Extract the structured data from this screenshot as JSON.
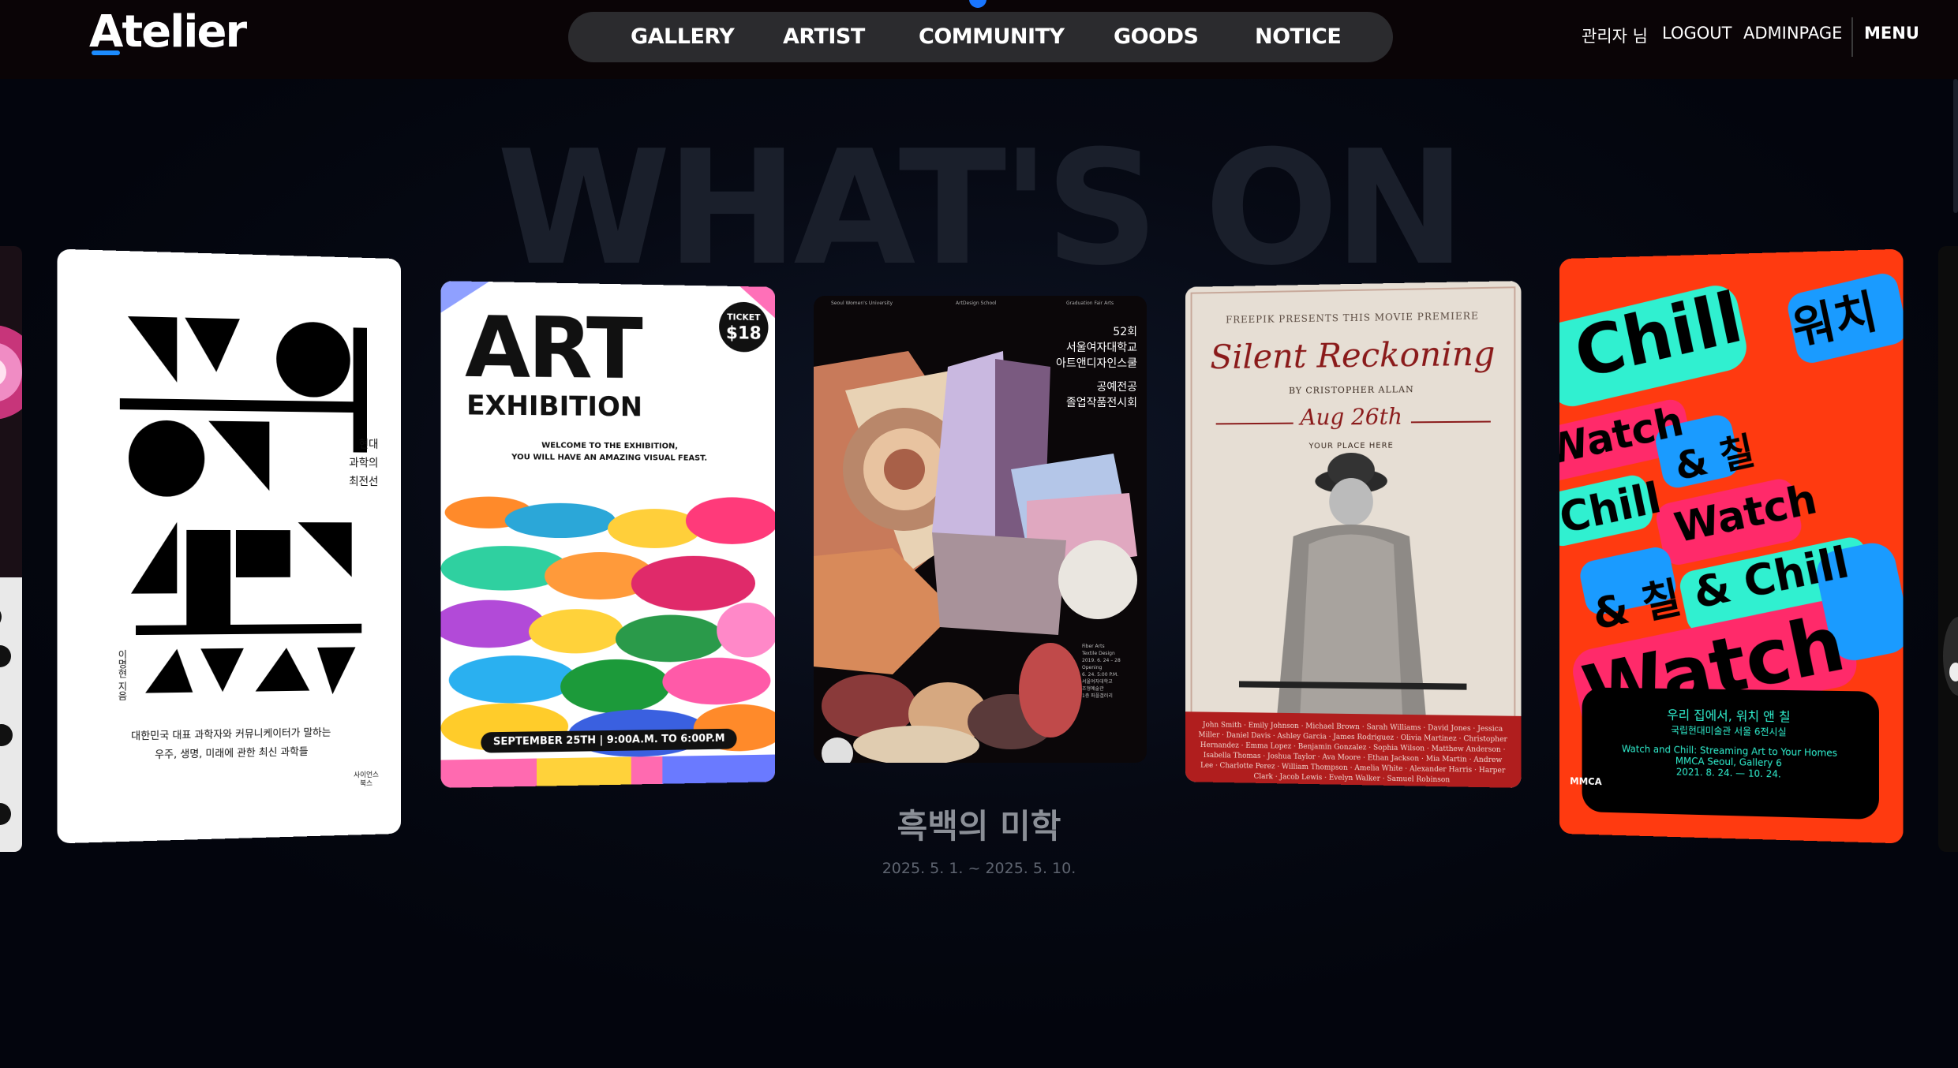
{
  "header": {
    "logo": "Atelier",
    "nav": [
      "GALLERY",
      "ARTIST",
      "COMMUNITY",
      "GOODS",
      "NOTICE"
    ],
    "user_label": "관리자 님",
    "logout": "LOGOUT",
    "adminpage": "ADMINPAGE",
    "menu": "MENU"
  },
  "hero": {
    "heading": "WHAT'S ON",
    "featured_title": "흑백의 미학",
    "featured_dates": "2025. 5. 1. ~ 2025. 5. 10."
  },
  "posters": {
    "p1": {
      "side_text": [
        "현대",
        "과학의",
        "최전선"
      ],
      "author": "이명현 지음",
      "desc_line1": "대한민국 대표 과학자와 커뮤니케이터가 말하는",
      "desc_line2": "우주, 생명, 미래에 관한 최신 과학들",
      "publisher": "사이언스 북스"
    },
    "p2": {
      "title": "ART",
      "subtitle": "EXHIBITION",
      "ticket_label": "TICKET",
      "ticket_price": "$18",
      "welcome1": "WELCOME TO THE EXHIBITION,",
      "welcome2": "YOU WILL HAVE AN AMAZING VISUAL FEAST.",
      "date_bar": "SEPTEMBER 25TH  |  9:00A.M. TO 6:00P.M"
    },
    "p3": {
      "top_left": "Seoul Women's University",
      "top_mid": "ArtDesign School",
      "top_right": "Graduation Fair Arts",
      "line1": "52회",
      "line2": "서울여자대학교",
      "line3": "아트앤디자인스쿨",
      "line4": "공예전공",
      "line5": "졸업작품전시회",
      "foot1": "Fiber Arts",
      "foot2": "Textile Design",
      "foot3": "2019. 6. 24 – 28",
      "foot4": "Opening",
      "foot5": "6. 24. 5:00 P.M.",
      "foot6": "서울여자대학교",
      "foot7": "조형예술관",
      "foot8": "1층 퍼플갤러리"
    },
    "p4": {
      "presents": "FREEPIK PRESENTS THIS MOVIE PREMIERE",
      "title": "Silent Reckoning",
      "by": "BY CRISTOPHER ALLAN",
      "date": "Aug 26th",
      "place": "YOUR PLACE HERE",
      "credits": "John Smith · Emily Johnson · Michael Brown · Sarah Williams · David Jones · Jessica Miller · Daniel Davis · Ashley Garcia · James Rodriguez · Olivia Martinez · Christopher Hernandez · Emma Lopez · Benjamin Gonzalez · Sophia Wilson · Matthew Anderson · Isabella Thomas · Joshua Taylor · Ava Moore · Ethan Jackson · Mia Martin · Andrew Lee · Charlotte Perez · William Thompson · Amelia White · Alexander Harris · Harper Clark · Jacob Lewis · Evelyn Walker · Samuel Robinson"
    },
    "p5": {
      "words": [
        "Chill",
        "워치",
        "Watch",
        "& 칠",
        "Chill",
        "Watch",
        "& 칠 & Chill",
        "Watch",
        "워치",
        "& 칠"
      ],
      "info1": "우리 집에서, 워치 앤 칠",
      "info2": "국립현대미술관 서울 6전시실",
      "info3": "Watch and Chill: Streaming Art to Your Homes",
      "info4": "MMCA Seoul, Gallery 6",
      "info5": "2021. 8. 24. — 10. 24.",
      "logo": "MMCA"
    }
  },
  "colors": {
    "accent": "#1976ff",
    "nav_bg": "#2b2b2e",
    "header_bg": "#0a0406",
    "page_bg": "#03050d"
  }
}
